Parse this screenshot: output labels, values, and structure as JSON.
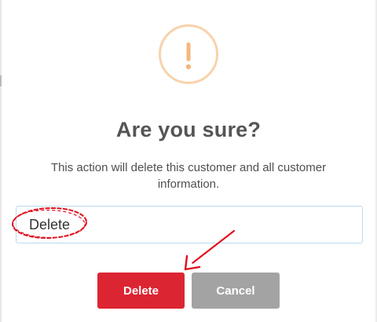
{
  "dialog": {
    "title": "Are you sure?",
    "message": "This action will delete this customer and all customer information.",
    "icon": "exclamation-icon",
    "input": {
      "value": "Delete",
      "placeholder": ""
    },
    "buttons": {
      "delete_label": "Delete",
      "cancel_label": "Cancel"
    }
  },
  "colors": {
    "icon_ring": "#f8d2ac",
    "icon_mark": "#f5b77e",
    "title": "#555555",
    "delete_button": "#dc2532",
    "cancel_button": "#a3a3a3",
    "input_border": "#b9dbee",
    "annotation": "#e0101e"
  }
}
